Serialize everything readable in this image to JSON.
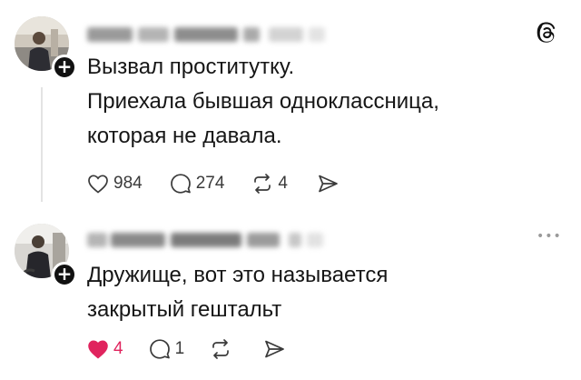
{
  "posts": [
    {
      "text_lines": [
        "Вызвал проститутку.",
        "Приехала бывшая одноклассница,",
        "которая не давала."
      ],
      "likes": "984",
      "comments": "274",
      "reposts": "4",
      "liked": false
    },
    {
      "text_lines": [
        "Дружище, вот это называется",
        "закрытый гештальт"
      ],
      "likes": "4",
      "comments": "1",
      "reposts": "",
      "liked": true
    }
  ],
  "icons": {
    "header": "threads-logo-icon",
    "more": "more-options-icon",
    "like": "heart-icon",
    "comment": "comment-bubble-icon",
    "repost": "repost-icon",
    "share": "send-icon",
    "follow": "plus-icon"
  },
  "colors": {
    "text": "#161616",
    "muted": "#3a3a3a",
    "liked": "#e0245e",
    "thread_line": "#e3e3e3"
  }
}
